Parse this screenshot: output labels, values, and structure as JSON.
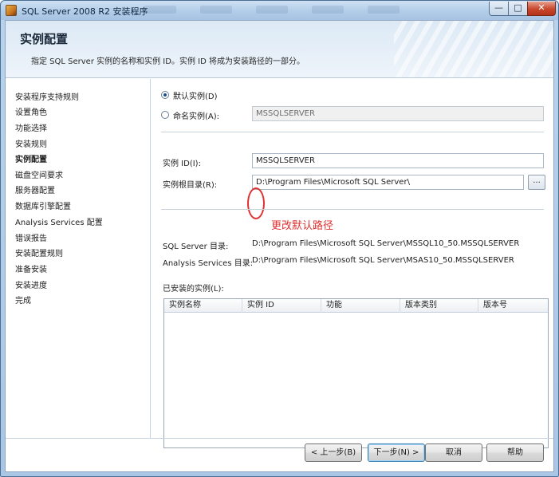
{
  "window": {
    "title": "SQL Server 2008 R2 安装程序",
    "controls": {
      "minimize": "—",
      "maximize": "□",
      "close": "✕"
    }
  },
  "header": {
    "title": "实例配置",
    "description": "指定 SQL Server 实例的名称和实例 ID。实例 ID 将成为安装路径的一部分。"
  },
  "nav": {
    "items": [
      {
        "label": "安装程序支持规则",
        "active": false
      },
      {
        "label": "设置角色",
        "active": false
      },
      {
        "label": "功能选择",
        "active": false
      },
      {
        "label": "安装规则",
        "active": false
      },
      {
        "label": "实例配置",
        "active": true
      },
      {
        "label": "磁盘空间要求",
        "active": false
      },
      {
        "label": "服务器配置",
        "active": false
      },
      {
        "label": "数据库引擎配置",
        "active": false
      },
      {
        "label": "Analysis Services 配置",
        "active": false
      },
      {
        "label": "错误报告",
        "active": false
      },
      {
        "label": "安装配置规则",
        "active": false
      },
      {
        "label": "准备安装",
        "active": false
      },
      {
        "label": "安装进度",
        "active": false
      },
      {
        "label": "完成",
        "active": false
      }
    ]
  },
  "form": {
    "default_instance_label": "默认实例(D)",
    "named_instance_label": "命名实例(A):",
    "named_instance_value": "MSSQLSERVER",
    "instance_id_label": "实例 ID(I):",
    "instance_id_value": "MSSQLSERVER",
    "instance_root_label": "实例根目录(R):",
    "instance_root_value": "D:\\Program Files\\Microsoft SQL Server\\",
    "browse_label": "...",
    "annotation": "更改默认路径",
    "sqlserver_dir_label": "SQL Server 目录:",
    "sqlserver_dir_value": "D:\\Program Files\\Microsoft SQL Server\\MSSQL10_50.MSSQLSERVER",
    "as_dir_label": "Analysis Services 目录:",
    "as_dir_value": "D:\\Program Files\\Microsoft SQL Server\\MSAS10_50.MSSQLSERVER",
    "installed_label": "已安装的实例(L):"
  },
  "table": {
    "columns": [
      "实例名称",
      "实例 ID",
      "功能",
      "版本类别",
      "版本号"
    ],
    "rows": []
  },
  "footer": {
    "back": "< 上一步(B)",
    "next": "下一步(N) >",
    "cancel": "取消",
    "help": "帮助"
  },
  "colors": {
    "annotation": "#e03030",
    "title_bar": "#b2cde9"
  }
}
